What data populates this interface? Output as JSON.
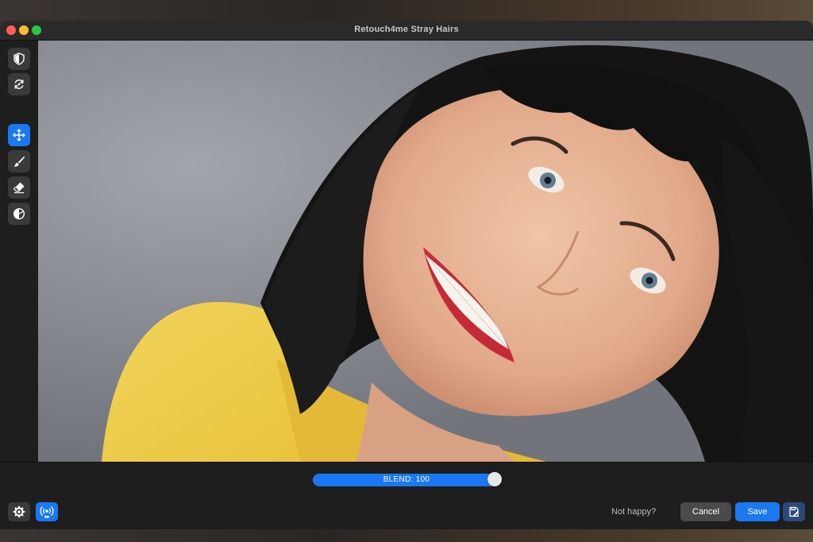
{
  "window": {
    "title": "Retouch4me Stray Hairs"
  },
  "toolbar": {
    "tools": [
      {
        "name": "shield-tool",
        "active": false
      },
      {
        "name": "refresh-tool",
        "active": false
      },
      {
        "name": "move-tool",
        "active": true
      },
      {
        "name": "brush-tool",
        "active": false
      },
      {
        "name": "eraser-tool",
        "active": false
      },
      {
        "name": "contrast-tool",
        "active": false
      }
    ]
  },
  "blend": {
    "label": "BLEND: 100",
    "value": 100
  },
  "footer": {
    "not_happy": "Not happy?",
    "cancel_label": "Cancel",
    "save_label": "Save"
  },
  "colors": {
    "accent": "#1a78f2",
    "window_bg": "#1e1e1e",
    "button_bg": "#3a3a3a"
  }
}
